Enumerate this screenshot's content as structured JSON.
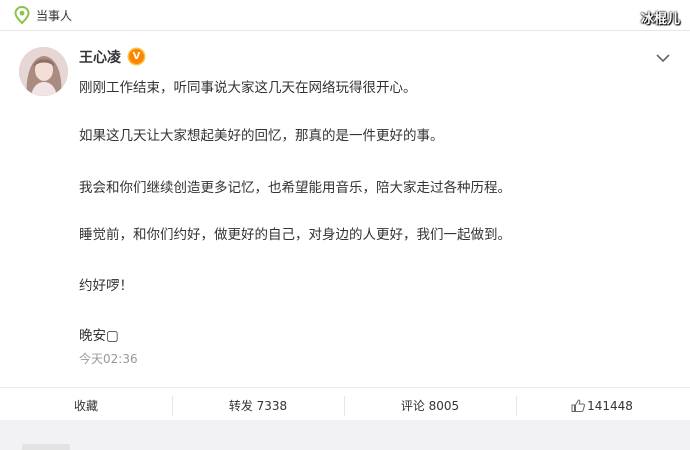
{
  "topbar": {
    "label": "当事人",
    "icon": "location-pin-icon",
    "icon_color": "#8bc34a"
  },
  "watermark": "冰棍儿",
  "post": {
    "username": "王心凌",
    "verified_badge": "V",
    "verified_color": "#ff8200",
    "paragraphs": [
      "刚刚工作结束，听同事说大家这几天在网络玩得很开心。",
      "如果这几天让大家想起美好的回忆，那真的是一件更好的事。",
      "我会和你们继续创造更多记忆，也希望能用音乐，陪大家走过各种历程。",
      "睡觉前，和你们约好，做更好的自己，对身边的人更好，我们一起做到。",
      "约好啰！",
      "晚安▢"
    ],
    "timestamp": "今天02:36"
  },
  "actions": {
    "favorite": "收藏",
    "repost": "转发 7338",
    "comment": "评论 8005",
    "like": "141448"
  }
}
